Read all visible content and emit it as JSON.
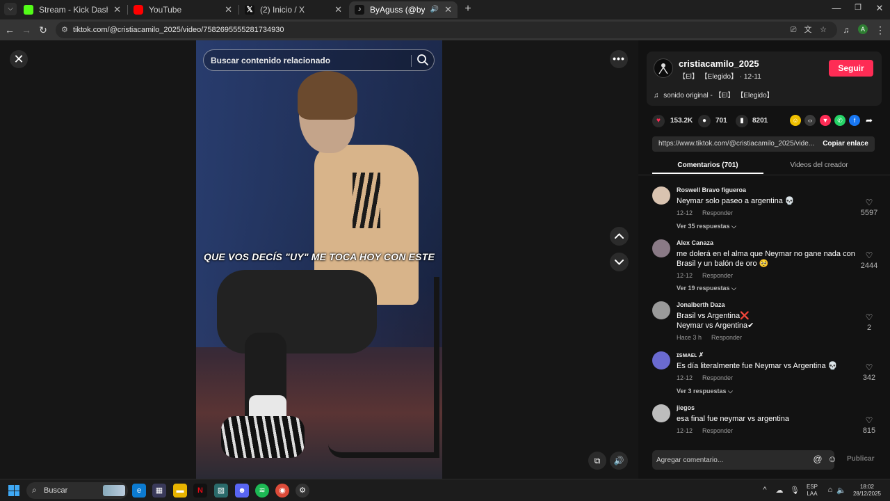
{
  "browser": {
    "tabs": [
      {
        "title": "Stream - Kick Dashboard",
        "favicon_color": "#53fc18",
        "active": false
      },
      {
        "title": "YouTube",
        "favicon_color": "#ff0000",
        "active": false
      },
      {
        "title": "(2) Inicio / X",
        "favicon_color": "#111111",
        "active": false
      },
      {
        "title": "ByAguss (@byagussteam) |",
        "favicon_color": "#111111",
        "active": true
      }
    ],
    "new_tab": "+",
    "url": "tiktok.com/@cristiacamilo_2025/video/7582695555281734930",
    "profile_initial": "A"
  },
  "page": {
    "search_placeholder": "Buscar contenido relacionado",
    "video_caption": "QUE VOS DECÍS \"UY\" ME TOCA HOY CON ESTE",
    "more_label": "•••"
  },
  "creator": {
    "username": "cristiacamilo_2025",
    "subline": "【El】 【Elegido】 · 12-11",
    "follow_label": "Seguir",
    "music": "sonido original - 【El】 【Elegido】"
  },
  "stats": {
    "likes": "153.2K",
    "comments": "701",
    "saves": "8201"
  },
  "share": {
    "link": "https://www.tiktok.com/@cristiacamilo_2025/vide...",
    "copy_label": "Copiar enlace"
  },
  "panel_tabs": {
    "comments": "Comentarios (701)",
    "creator_videos": "Videos del creador"
  },
  "comments": [
    {
      "user": "Roswell Bravo figueroa",
      "lines": [
        "Neymar solo paseo a argentina 💀"
      ],
      "date": "12-12",
      "reply": "Responder",
      "likes": "5597",
      "more": "Ver 35 respuestas ⌵",
      "avatar_color": "#d9c3b0"
    },
    {
      "user": "Alex Canaza",
      "lines": [
        "me dolerá en el alma que Neymar no gane nada con",
        "Brasil y un balón de oro 🥺"
      ],
      "date": "12-12",
      "reply": "Responder",
      "likes": "2444",
      "more": "Ver 19 respuestas ⌵",
      "avatar_color": "#8a7a86"
    },
    {
      "user": "Jonalberth Daza",
      "lines": [
        "Brasil vs Argentina❌",
        "Neymar vs Argentina✔"
      ],
      "date": "Hace 3 h",
      "reply": "Responder",
      "likes": "2",
      "more": "",
      "avatar_color": "#9a9a9a"
    },
    {
      "user": "ɪsᴍᴀᴇʟ ✗",
      "lines": [
        "Es día literalmente fue Neymar vs Argentina 💀"
      ],
      "date": "12-12",
      "reply": "Responder",
      "likes": "342",
      "more": "Ver 3 respuestas ⌵",
      "avatar_color": "#6a6ad0"
    },
    {
      "user": "jiegos",
      "lines": [
        "esa final fue neymar vs argentina"
      ],
      "date": "12-12",
      "reply": "Responder",
      "likes": "815",
      "more": "",
      "avatar_color": "#bdbdbd"
    }
  ],
  "composer": {
    "placeholder": "Agregar comentario...",
    "post_label": "Publicar"
  },
  "taskbar": {
    "search_label": "Buscar",
    "lang_line1": "ESP",
    "lang_line2": "LAA",
    "time": "18:02",
    "date": "28/12/2025"
  }
}
